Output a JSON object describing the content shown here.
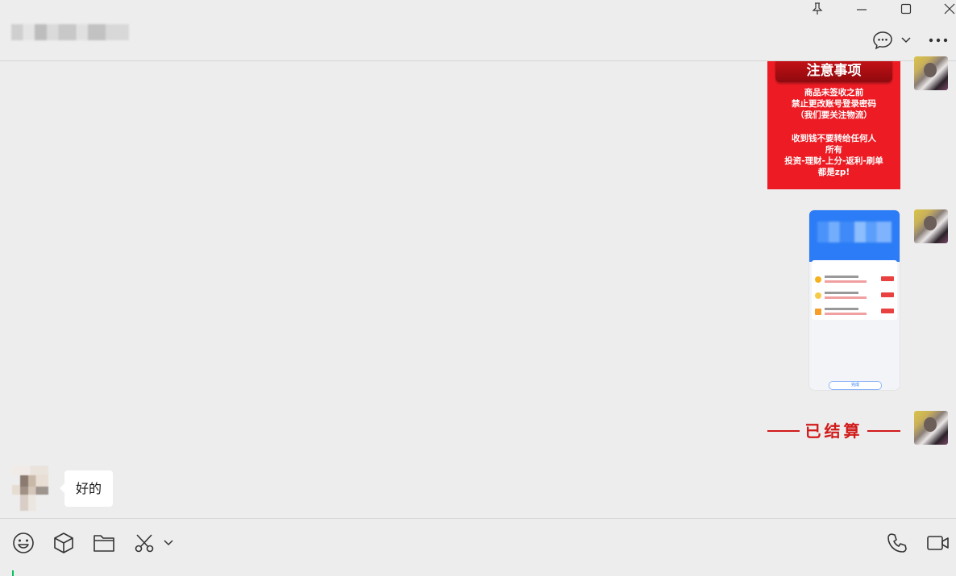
{
  "window": {
    "title": "",
    "controls": [
      "pin-icon",
      "minimize-icon",
      "maximize-icon",
      "close-icon"
    ]
  },
  "header": {
    "icons": [
      "chat-bubble-icon",
      "chevron-down-icon",
      "more-icon"
    ]
  },
  "messages": [
    {
      "from": "self",
      "type": "image",
      "notice": {
        "heading": "注意事项",
        "lines": [
          "商品未签收之前",
          "禁止更改账号登录密码",
          "（我们要关注物流）",
          "",
          "收到钱不要转给任何人",
          "所有",
          "投资-理财-上分-返利-刷单",
          "都是zp!"
        ]
      }
    },
    {
      "from": "self",
      "type": "image",
      "screenshot": {
        "bottom_button": "完成"
      }
    },
    {
      "from": "self",
      "type": "image",
      "stamp_text": "已结算"
    },
    {
      "from": "other",
      "type": "text",
      "text": "好的"
    }
  ],
  "toolbar": {
    "left_icons": [
      "emoji-icon",
      "box-icon",
      "folder-icon",
      "scissors-icon",
      "chevron-down-icon"
    ],
    "right_icons": [
      "phone-icon",
      "video-icon"
    ]
  },
  "colors": {
    "background": "#ededed",
    "notice_red": "#ed1c24",
    "stamp_red": "#d11a1a",
    "caret_green": "#07c160"
  }
}
